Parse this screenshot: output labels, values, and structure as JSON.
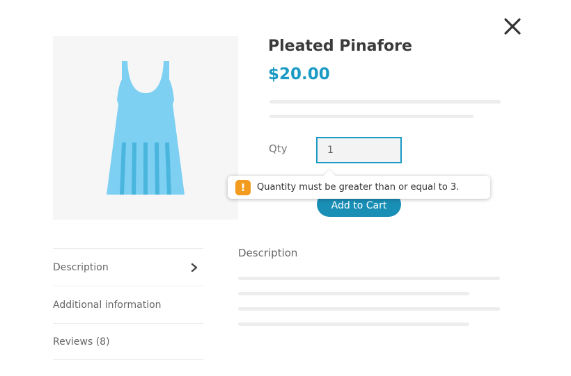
{
  "product": {
    "title": "Pleated Pinafore",
    "price": "$20.00",
    "image_icon": "dress-icon",
    "dress_color": "#7ed0f3",
    "pleat_color": "#4ab5dd"
  },
  "form": {
    "qty_label": "Qty",
    "qty_value": "1",
    "add_to_cart_label": "Add to Cart"
  },
  "validation": {
    "icon": "!",
    "message": "Quantity must be greater than or equal to 3."
  },
  "tabs": [
    {
      "label": "Description",
      "active": true
    },
    {
      "label": "Additional information",
      "active": false
    },
    {
      "label": "Reviews (8)",
      "active": false
    }
  ],
  "description": {
    "heading": "Description"
  },
  "colors": {
    "accent": "#1a9ac4",
    "button": "#1a8fb6",
    "warning": "#f39b1e"
  }
}
